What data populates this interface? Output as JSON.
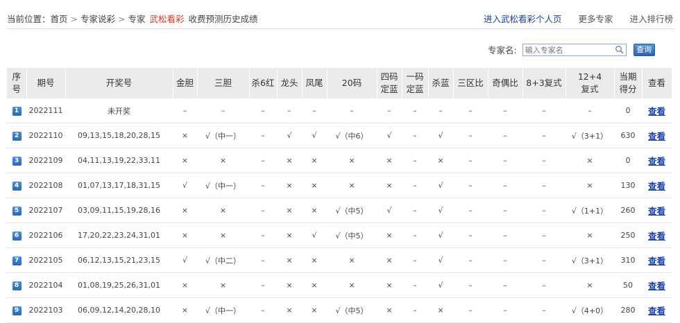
{
  "breadcrumb": {
    "prefix": "当前位置：",
    "items": [
      "首页",
      "专家说彩",
      "专家"
    ],
    "expert_name": "武松看彩",
    "suffix": "收费预测历史成绩"
  },
  "top_links": {
    "personal_page": "进入武松看彩个人页",
    "more_experts": "更多专家",
    "ranking": "进入排行榜"
  },
  "search": {
    "label": "专家名:",
    "placeholder": "输入专家名",
    "button": "查询"
  },
  "table": {
    "headers": [
      "序\n号",
      "期号",
      "开奖号",
      "金胆",
      "三胆",
      "杀6红",
      "龙头",
      "凤尾",
      "20码",
      "四码\n定蓝",
      "一码\n定蓝",
      "杀蓝",
      "三区比",
      "奇偶比",
      "8+3复式",
      "12+4\n复式",
      "当期\n得分",
      "查看"
    ],
    "view_label": "查看",
    "rows": [
      {
        "rank": "1",
        "issue": "2022111",
        "numbers": "未开奖",
        "jindan": "–",
        "sandan": "–",
        "sha6": "–",
        "longtou": "–",
        "fengwei": "–",
        "ma20": "–",
        "sima": "–",
        "yima": "–",
        "shalan": "–",
        "sanqu": "–",
        "jiou": "–",
        "f83": "–",
        "f124": "–",
        "score": "0"
      },
      {
        "rank": "2",
        "issue": "2022110",
        "numbers": "09,13,15,18,20,28,15",
        "jindan": "×",
        "sandan": "√（中一）",
        "sha6": "–",
        "longtou": "√",
        "fengwei": "√",
        "ma20": "√（中6）",
        "sima": "√",
        "yima": "–",
        "shalan": "√",
        "sanqu": "–",
        "jiou": "–",
        "f83": "–",
        "f124": "√（3+1）",
        "score": "630"
      },
      {
        "rank": "3",
        "issue": "2022109",
        "numbers": "04,11,13,19,22,33,11",
        "jindan": "×",
        "sandan": "×",
        "sha6": "–",
        "longtou": "×",
        "fengwei": "×",
        "ma20": "×",
        "sima": "×",
        "yima": "–",
        "shalan": "×",
        "sanqu": "–",
        "jiou": "–",
        "f83": "–",
        "f124": "×",
        "score": "0"
      },
      {
        "rank": "4",
        "issue": "2022108",
        "numbers": "01,07,13,17,18,31,15",
        "jindan": "√",
        "sandan": "√（中一）",
        "sha6": "–",
        "longtou": "×",
        "fengwei": "×",
        "ma20": "×",
        "sima": "×",
        "yima": "–",
        "shalan": "√",
        "sanqu": "–",
        "jiou": "–",
        "f83": "–",
        "f124": "×",
        "score": "130"
      },
      {
        "rank": "5",
        "issue": "2022107",
        "numbers": "03,09,11,15,19,28,16",
        "jindan": "×",
        "sandan": "×",
        "sha6": "–",
        "longtou": "×",
        "fengwei": "×",
        "ma20": "√（中5）",
        "sima": "√",
        "yima": "–",
        "shalan": "√",
        "sanqu": "–",
        "jiou": "–",
        "f83": "–",
        "f124": "√（1+1）",
        "score": "260"
      },
      {
        "rank": "6",
        "issue": "2022106",
        "numbers": "17,20,22,23,24,31,01",
        "jindan": "×",
        "sandan": "×",
        "sha6": "–",
        "longtou": "×",
        "fengwei": "√",
        "ma20": "√（中5）",
        "sima": "×",
        "yima": "–",
        "shalan": "√",
        "sanqu": "–",
        "jiou": "–",
        "f83": "–",
        "f124": "×",
        "score": "250"
      },
      {
        "rank": "7",
        "issue": "2022105",
        "numbers": "06,12,13,15,21,23,15",
        "jindan": "√",
        "sandan": "√（中二）",
        "sha6": "–",
        "longtou": "×",
        "fengwei": "×",
        "ma20": "×",
        "sima": "×",
        "yima": "–",
        "shalan": "√",
        "sanqu": "–",
        "jiou": "–",
        "f83": "–",
        "f124": "√（3+1）",
        "score": "310"
      },
      {
        "rank": "8",
        "issue": "2022104",
        "numbers": "01,08,19,25,26,31,01",
        "jindan": "×",
        "sandan": "×",
        "sha6": "–",
        "longtou": "×",
        "fengwei": "×",
        "ma20": "×",
        "sima": "×",
        "yima": "–",
        "shalan": "√",
        "sanqu": "–",
        "jiou": "–",
        "f83": "–",
        "f124": "×",
        "score": "50"
      },
      {
        "rank": "9",
        "issue": "2022103",
        "numbers": "06,09,12,14,20,28,10",
        "jindan": "×",
        "sandan": "√（中一）",
        "sha6": "–",
        "longtou": "×",
        "fengwei": "×",
        "ma20": "√（中5）",
        "sima": "×",
        "yima": "–",
        "shalan": "×",
        "sanqu": "–",
        "jiou": "–",
        "f83": "–",
        "f124": "√（4+0）",
        "score": "280"
      }
    ]
  },
  "colors": {
    "accent_red": "#d62b12",
    "link_blue": "#1a43a8",
    "header_bg": "#ebebeb"
  },
  "icons": {
    "search": "magnifier-icon",
    "rank": "rank-badge-icon"
  }
}
